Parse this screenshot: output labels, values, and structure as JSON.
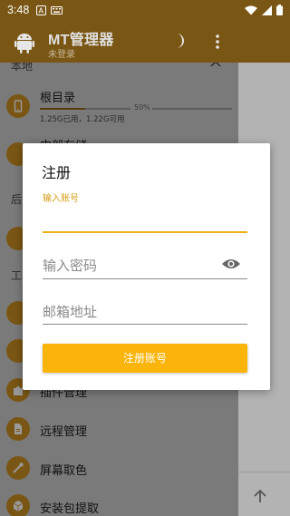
{
  "status_bar": {
    "time": "3:48"
  },
  "app_bar": {
    "title": "MT管理器",
    "subtitle": "未登录"
  },
  "drawer": {
    "header_fragment": "本地",
    "root": {
      "title": "根目录",
      "usage_percent": 50,
      "usage_label": "50%",
      "usage_text": "1.25G已用，1.22G可用"
    },
    "internal_storage_fragment": "内部存储",
    "side_fragment_1": "后",
    "side_fragment_2": "工",
    "items": [
      {
        "label": "插件管理",
        "icon": "plugin-icon"
      },
      {
        "label": "远程管理",
        "icon": "remote-file-icon"
      },
      {
        "label": "屏幕取色",
        "icon": "color-picker-icon"
      },
      {
        "label": "安装包提取",
        "icon": "package-icon"
      }
    ]
  },
  "dialog": {
    "title": "注册",
    "account_label": "输入账号",
    "password_placeholder": "输入密码",
    "email_placeholder": "邮箱地址",
    "submit_label": "注册账号"
  },
  "colors": {
    "accent": "#fbb40a",
    "primary_dark": "#7a5614",
    "field_active": "#e9b210"
  }
}
